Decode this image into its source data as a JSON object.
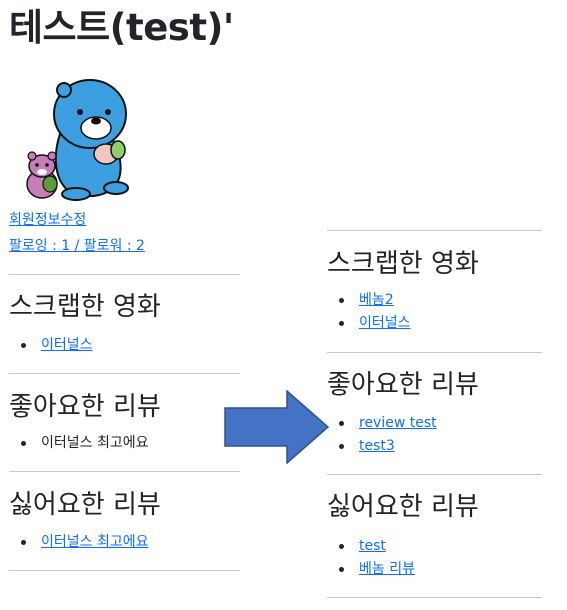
{
  "page": {
    "title": "테스트(test)'"
  },
  "profile": {
    "edit_link": "회원정보수정",
    "follow_link": "팔로잉 : 1 / 팔로워 : 2"
  },
  "left_panel": {
    "scrapped": {
      "heading": "스크랩한 영화",
      "items": [
        "이터널스"
      ]
    },
    "liked": {
      "heading": "좋아요한 리뷰",
      "items": [
        "이터널스 최고에요"
      ]
    },
    "disliked": {
      "heading": "싫어요한 리뷰",
      "items": [
        "이터널스 최고에요"
      ]
    }
  },
  "right_panel": {
    "scrapped": {
      "heading": "스크랩한 영화",
      "items": [
        "베놈2",
        "이터널스"
      ]
    },
    "liked": {
      "heading": "좋아요한 리뷰",
      "items": [
        "review test",
        "test3"
      ]
    },
    "disliked": {
      "heading": "싫어요한 리뷰",
      "items": [
        "test",
        "베놈 리뷰"
      ]
    }
  },
  "icons": {
    "avatar": "otter-mascot-avatar",
    "arrow": "right-arrow-icon"
  },
  "colors": {
    "link": "#0d6efd",
    "arrow_fill": "#4472c4",
    "arrow_stroke": "#2f528f",
    "divider": "#c8c8c8"
  }
}
